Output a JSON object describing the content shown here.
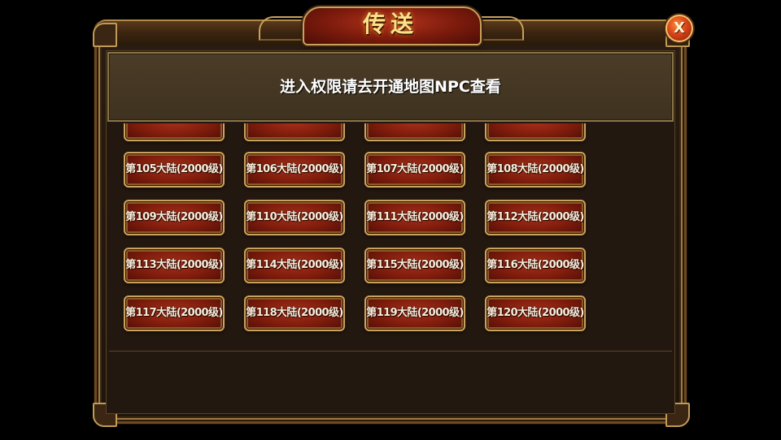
{
  "dialog": {
    "title": "传送",
    "close_label": "X",
    "notice": "进入权限请去开通地图NPC查看"
  },
  "map_buttons": [
    {
      "label": ""
    },
    {
      "label": ""
    },
    {
      "label": ""
    },
    {
      "label": ""
    },
    {
      "label": "第105大陆(2000级)"
    },
    {
      "label": "第106大陆(2000级)"
    },
    {
      "label": "第107大陆(2000级)"
    },
    {
      "label": "第108大陆(2000级)"
    },
    {
      "label": "第109大陆(2000级)"
    },
    {
      "label": "第110大陆(2000级)"
    },
    {
      "label": "第111大陆(2000级)"
    },
    {
      "label": "第112大陆(2000级)"
    },
    {
      "label": "第113大陆(2000级)"
    },
    {
      "label": "第114大陆(2000级)"
    },
    {
      "label": "第115大陆(2000级)"
    },
    {
      "label": "第116大陆(2000级)"
    },
    {
      "label": "第117大陆(2000级)"
    },
    {
      "label": "第118大陆(2000级)"
    },
    {
      "label": "第119大陆(2000级)"
    },
    {
      "label": "第120大陆(2000级)"
    }
  ],
  "colors": {
    "background": "#000000",
    "frame_gold": "#c9a25e",
    "button_red": "#7e1c0c",
    "notice_bg": "#4a3c26",
    "title_gold": "#ffe08a"
  }
}
